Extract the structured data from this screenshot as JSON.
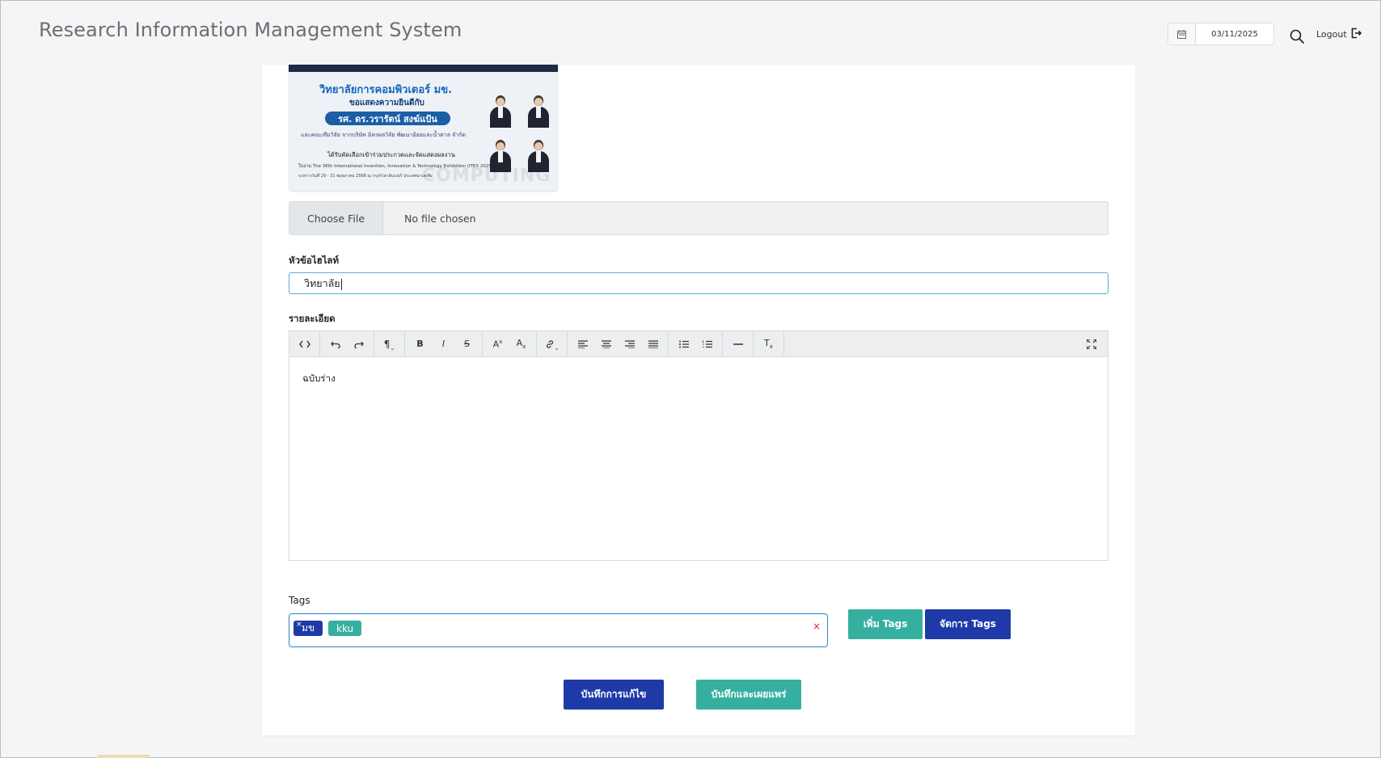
{
  "header": {
    "title": "Research Information Management System",
    "date_value": "03/11/2025",
    "logout_label": "Logout"
  },
  "banner": {
    "title": "วิทยาลัยการคอมพิวเตอร์ มข.",
    "subtitle": "ขอแสดงความยินดีกับ",
    "name": "รศ. ดร.วรารัตน์ สงฆ์แป้น",
    "line1": "และคณะทีมวิจัย จากบริษัท มิตรผลวิจัย พัฒนาอ้อยและน้ำตาล จำกัด",
    "line2": "ได้รับคัดเลือกเข้าร่วมประกวดและจัดแสดงผลงาน",
    "line3": "ในงาน The 36th International Invention, Innovation & Technology Exhibition (ITEX 2025)",
    "line4": "ระหว่างวันที่ 29 - 31 พฤษภาคม 2568 ณ กรุงกัวลาลัมเปอร์ ประเทศมาเลเซีย",
    "watermark": "COMPUTING"
  },
  "file_input": {
    "button_label": "Choose File",
    "status": "No file chosen"
  },
  "headline": {
    "label": "หัวข้อไฮไลท์",
    "value": "วิทยาลัย"
  },
  "detail": {
    "label": "รายละเอียด",
    "content": "ฉบับร่าง",
    "toolbar_icons": [
      "code-view-icon",
      "undo-icon",
      "redo-icon",
      "paragraph-icon",
      "bold-icon",
      "italic-icon",
      "strikethrough-icon",
      "superscript-icon",
      "subscript-icon",
      "link-icon",
      "align-left-icon",
      "align-center-icon",
      "align-right-icon",
      "align-justify-icon",
      "bullet-list-icon",
      "numbered-list-icon",
      "horizontal-rule-icon",
      "clear-format-icon",
      "fullscreen-icon"
    ]
  },
  "tags": {
    "label": "Tags",
    "items": [
      "มข",
      "kku"
    ],
    "clear_symbol": "×",
    "add_button": "เพิ่ม Tags",
    "manage_button": "จัดการ Tags"
  },
  "actions": {
    "save_edit": "บันทึกการแก้ไข",
    "save_publish": "บันทึกและเผยแพร่"
  },
  "colors": {
    "primary": "#1e3aa8",
    "teal": "#35b0a0",
    "focus_border": "#2a86c8"
  }
}
